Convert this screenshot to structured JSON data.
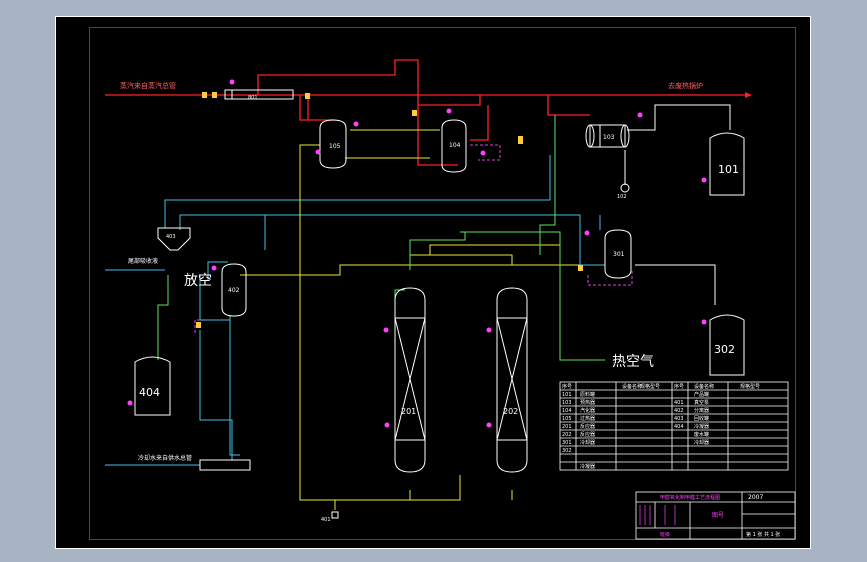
{
  "drawing": {
    "colors": {
      "background": "#a8b4c4",
      "sheet": "#000000",
      "frame_outer": "#ffffff",
      "frame_inner": "#2a2aff",
      "steam": "#ff2020",
      "air": "#40c0e0",
      "product": "#ffff40",
      "hot": "#d05050",
      "cooling": "#60ff60",
      "vent": "#ff40ff",
      "equipment": "#ffffff"
    },
    "labels": {
      "steam_in": "蒸汽来自蒸汽总管",
      "to_boiler": "去废热锅炉",
      "vent_big": "放空",
      "hot_air_big": "热空气",
      "tail_gas": "尾部吸收液",
      "cooling_water": "冷却水来自供水总管"
    },
    "equipment": {
      "e101": "101",
      "e102": "102",
      "e103": "103",
      "e104": "104",
      "e105": "105",
      "e201": "201",
      "e202": "202",
      "e301": "301",
      "e302": "302",
      "e401": "401",
      "e402": "402",
      "e403": "403",
      "e404": "404",
      "e801": "801"
    },
    "legend": {
      "headers": [
        "序号",
        "设备名称",
        "规格型号",
        "序号",
        "设备名称",
        "规格型号"
      ],
      "rows": [
        [
          "101",
          "原料罐",
          "",
          "",
          "产品罐",
          ""
        ],
        [
          "103",
          "预热器",
          "",
          "401",
          "真空泵",
          ""
        ],
        [
          "104",
          "汽化器",
          "",
          "402",
          "分离器",
          ""
        ],
        [
          "105",
          "过热器",
          "",
          "403",
          "回收罐",
          ""
        ],
        [
          "201",
          "反应器",
          "",
          "404",
          "冷凝器",
          ""
        ],
        [
          "202",
          "反应器",
          "",
          "",
          "废水罐",
          ""
        ],
        [
          "301",
          "冷却器",
          "",
          "",
          "冷却器",
          ""
        ],
        [
          "302",
          "",
          "",
          "",
          "",
          ""
        ],
        [
          "",
          "",
          "",
          "",
          "",
          ""
        ],
        [
          "",
          "冷凝器",
          "",
          "",
          "",
          ""
        ]
      ]
    },
    "title_block": {
      "year": "2007",
      "title": "甲醇氧化制甲醛工艺流程图",
      "drawing_name": "图号",
      "company": "班级",
      "sheet": "第 1 张 共 1 张"
    }
  }
}
